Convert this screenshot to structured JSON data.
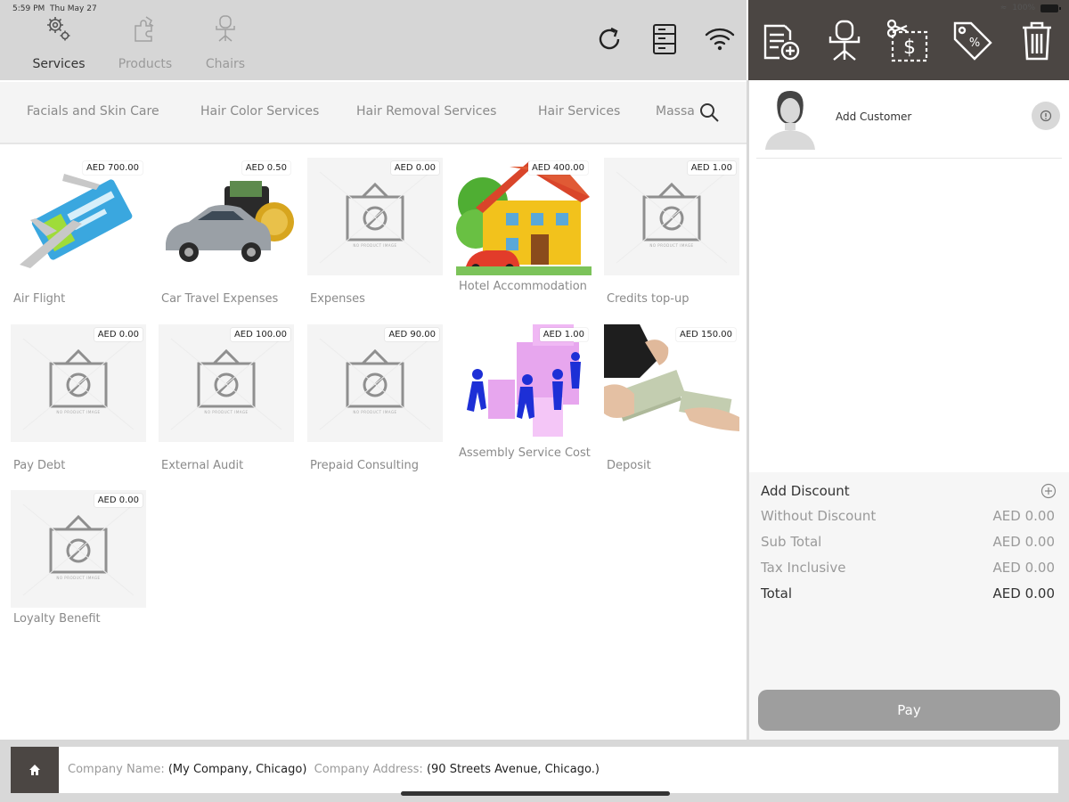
{
  "status_bar": {
    "time": "5:59 PM",
    "date": "Thu May 27",
    "battery": "100%"
  },
  "nav_tabs": [
    {
      "label": "Services",
      "icon": "gear-icon",
      "active": true
    },
    {
      "label": "Products",
      "icon": "puzzle-icon",
      "active": false
    },
    {
      "label": "Chairs",
      "icon": "chair-icon",
      "active": false
    }
  ],
  "top_actions": [
    "refresh-icon",
    "server-icon",
    "wifi-icon"
  ],
  "right_toolbar": [
    "new-order-icon",
    "chair-icon",
    "cut-price-icon",
    "tag-icon",
    "trash-icon"
  ],
  "categories": [
    "Facials and Skin Care",
    "Hair Color Services",
    "Hair Removal Services",
    "Hair Services",
    "Massa"
  ],
  "products": [
    {
      "name": "Air Flight",
      "price": "AED 700.00",
      "image": "flight"
    },
    {
      "name": "Car Travel Expenses",
      "price": "AED 0.50",
      "image": "car"
    },
    {
      "name": "Expenses",
      "price": "AED 0.00",
      "image": "none"
    },
    {
      "name": "Hotel Accommodation",
      "price": "AED 400.00",
      "image": "house"
    },
    {
      "name": "Credits top-up",
      "price": "AED 1.00",
      "image": "none"
    },
    {
      "name": "Pay Debt",
      "price": "AED 0.00",
      "image": "none"
    },
    {
      "name": "External Audit",
      "price": "AED 100.00",
      "image": "none"
    },
    {
      "name": "Prepaid Consulting",
      "price": "AED 90.00",
      "image": "none"
    },
    {
      "name": "Assembly Service Cost",
      "price": "AED 1.00",
      "image": "puzzle"
    },
    {
      "name": "Deposit",
      "price": "AED 150.00",
      "image": "money"
    },
    {
      "name": "Loyalty Benefit",
      "price": "AED 0.00",
      "image": "none"
    }
  ],
  "no_image_text": "NO PRODUCT IMAGE",
  "customer": {
    "label": "Add Customer"
  },
  "summary": {
    "add_discount": "Add Discount",
    "rows": [
      {
        "label": "Without Discount",
        "value": "AED 0.00"
      },
      {
        "label": "Sub Total",
        "value": "AED 0.00"
      },
      {
        "label": "Tax Inclusive",
        "value": "AED 0.00"
      },
      {
        "label": "Total",
        "value": "AED 0.00"
      }
    ]
  },
  "pay_label": "Pay",
  "footer": {
    "company_name_label": "Company Name:",
    "company_name": "(My Company, Chicago)",
    "company_address_label": "Company Address:",
    "company_address": "(90 Streets Avenue, Chicago.)"
  },
  "colors": {
    "dark_toolbar": "#4b4643",
    "top_bar": "#d6d6d6",
    "pay_button": "#9e9e9e"
  }
}
